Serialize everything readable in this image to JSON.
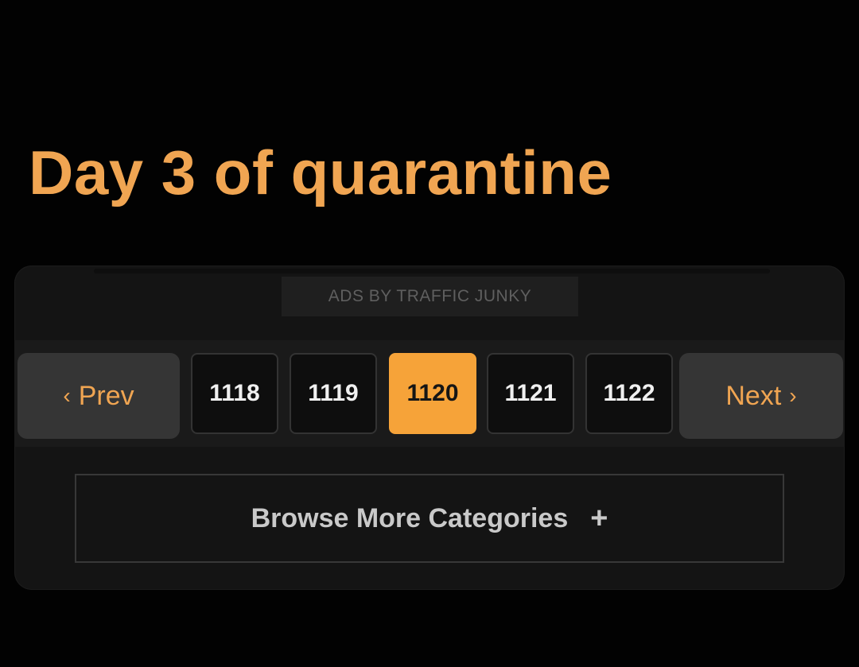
{
  "headline": "Day 3 of quarantine",
  "ads_label": "ADS BY TRAFFIC JUNKY",
  "pagination": {
    "prev_label": "Prev",
    "next_label": "Next",
    "pages": [
      "1118",
      "1119",
      "1120",
      "1121",
      "1122"
    ],
    "current_page": "1120",
    "chevron_left": "‹",
    "chevron_right": "›"
  },
  "browse": {
    "label": "Browse More Categories",
    "plus": "+"
  },
  "colors": {
    "background": "#020202",
    "accent_orange": "#f6a339",
    "headline_orange": "#f0a552",
    "panel": "#141414",
    "button_gray": "#353535"
  }
}
